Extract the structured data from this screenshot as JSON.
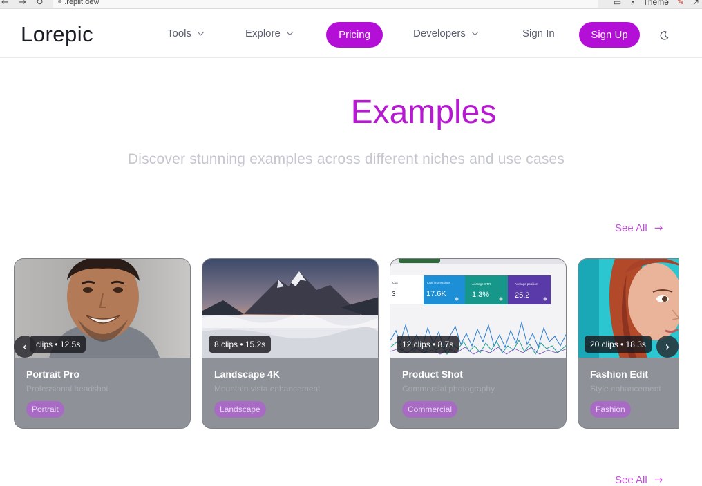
{
  "browser": {
    "url": ".replit.dev/",
    "theme_label": "Theme"
  },
  "header": {
    "logo": "Lorepic",
    "nav": {
      "tools": "Tools",
      "explore": "Explore",
      "pricing": "Pricing",
      "developers": "Developers",
      "sign_in": "Sign In",
      "sign_up": "Sign Up"
    },
    "accent_color": "#b40fd6"
  },
  "hero": {
    "title": "Examples",
    "subtitle": "Discover stunning examples across different niches and use cases"
  },
  "section1": {
    "see_all": "See All"
  },
  "section2": {
    "see_all": "See All"
  },
  "cards": [
    {
      "badge": "clips • 12.5s",
      "title": "Portrait Pro",
      "description": "Professional headshot",
      "tag": "Portrait"
    },
    {
      "badge": "8 clips • 15.2s",
      "title": "Landscape 4K",
      "description": "Mountain vista enhancement",
      "tag": "Landscape"
    },
    {
      "badge": "12 clips • 8.7s",
      "title": "Product Shot",
      "description": "Commercial photography",
      "tag": "Commercial"
    },
    {
      "badge": "20 clips • 18.3s",
      "title": "Fashion Edit",
      "description": "Style enhancement",
      "tag": "Fashion"
    }
  ],
  "dashboard_image": {
    "stat1": "17.6K",
    "stat2": "1.3%",
    "stat3": "25.2",
    "partial": "3",
    "label1": "Total impressions",
    "label2": "Average CTR",
    "label3": "Average position",
    "label0": "icks"
  }
}
